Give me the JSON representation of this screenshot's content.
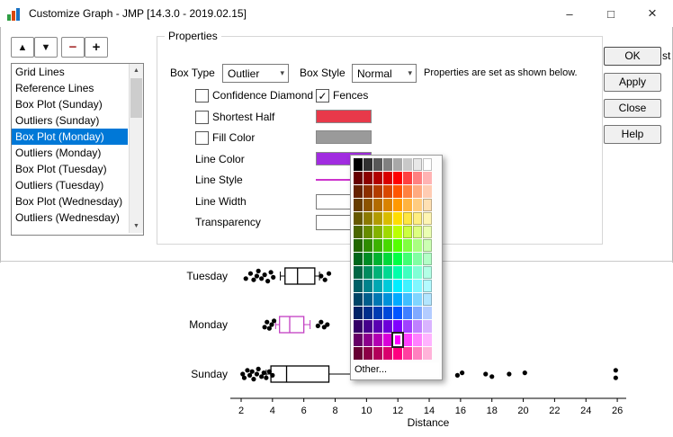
{
  "window": {
    "title": "Customize Graph - JMP [14.3.0 - 2019.02.15]",
    "controls": {
      "minimize": "–",
      "maximize": "□",
      "close": "×"
    },
    "edge_fragment": "st"
  },
  "movers": {
    "up": "▲",
    "down": "▼",
    "remove": "−",
    "add": "+"
  },
  "list": {
    "items": [
      "Grid Lines",
      "Reference Lines",
      "Box Plot (Sunday)",
      "Outliers (Sunday)",
      "Box Plot (Monday)",
      "Outliers (Monday)",
      "Box Plot (Tuesday)",
      "Outliers (Tuesday)",
      "Box Plot (Wednesday)",
      "Outliers (Wednesday)"
    ],
    "selected_index": 4
  },
  "properties": {
    "legend": "Properties",
    "box_type_label": "Box Type",
    "box_type_value": "Outlier",
    "box_style_label": "Box Style",
    "box_style_value": "Normal",
    "note": "Properties are set as shown below.",
    "rows": [
      {
        "type": "checkbox",
        "label": "Confidence Diamond",
        "checked": false,
        "row": 0,
        "col": 0
      },
      {
        "type": "checkbox",
        "label": "Fences",
        "checked": true,
        "row": 0,
        "col": 1
      },
      {
        "type": "checkbox",
        "label": "Shortest Half",
        "checked": false,
        "row": 1,
        "swatch": "#e8394a"
      },
      {
        "type": "checkbox",
        "label": "Fill Color",
        "checked": false,
        "row": 2,
        "swatch": "#9a9a9a"
      },
      {
        "type": "label",
        "label": "Line Color",
        "row": 3,
        "swatch": "#a12ce0"
      },
      {
        "type": "label",
        "label": "Line Style",
        "row": 4,
        "line": "#cc33cc"
      },
      {
        "type": "label",
        "label": "Line Width",
        "row": 5,
        "field": true
      },
      {
        "type": "label",
        "label": "Transparency",
        "row": 6,
        "field": true
      }
    ]
  },
  "action_buttons": [
    "OK",
    "Apply",
    "Close",
    "Help"
  ],
  "palette": {
    "other_label": "Other...",
    "selected": {
      "row": 13,
      "col": 4
    },
    "rows": [
      [
        "#000000",
        "#303030",
        "#585858",
        "#808080",
        "#a8a8a8",
        "#c8c8c8",
        "#e8e8e8",
        "#ffffff"
      ],
      [
        "#660000",
        "#8c0000",
        "#b20000",
        "#d90000",
        "#ff0000",
        "#ff4040",
        "#ff8080",
        "#ffb3b3"
      ],
      [
        "#662200",
        "#8c2f00",
        "#b23c00",
        "#d94800",
        "#ff5500",
        "#ff8040",
        "#ffaa80",
        "#ffccb3"
      ],
      [
        "#663d00",
        "#8c5400",
        "#b26b00",
        "#d98200",
        "#ff9900",
        "#ffb340",
        "#ffcc80",
        "#ffe0b3"
      ],
      [
        "#665800",
        "#8c7a00",
        "#b29b00",
        "#d9bc00",
        "#ffdd00",
        "#ffe640",
        "#ffee80",
        "#fff5b3"
      ],
      [
        "#4b6600",
        "#678c00",
        "#83b200",
        "#9fd900",
        "#bbff00",
        "#ccff40",
        "#ddff80",
        "#ebffb3"
      ],
      [
        "#226600",
        "#2f8c00",
        "#3cb200",
        "#48d900",
        "#55ff00",
        "#80ff40",
        "#aaff80",
        "#ccffb3"
      ],
      [
        "#00661b",
        "#008c25",
        "#00b230",
        "#00d93a",
        "#00ff44",
        "#40ff73",
        "#80ffa2",
        "#b3ffc7"
      ],
      [
        "#006644",
        "#008c5e",
        "#00b277",
        "#00d991",
        "#00ffaa",
        "#40ffbf",
        "#80ffd5",
        "#b3ffe6"
      ],
      [
        "#005f66",
        "#00838c",
        "#00a7b2",
        "#00cad9",
        "#00eeff",
        "#40f2ff",
        "#80f7ff",
        "#b3faff"
      ],
      [
        "#004466",
        "#005e8c",
        "#0077b2",
        "#0091d9",
        "#00aaff",
        "#40bfff",
        "#80d5ff",
        "#b3e6ff"
      ],
      [
        "#002266",
        "#002f8c",
        "#003cb2",
        "#0048d9",
        "#0055ff",
        "#4080ff",
        "#80aaff",
        "#b3ccff"
      ],
      [
        "#330066",
        "#46008c",
        "#5a00b2",
        "#6d00d9",
        "#8000ff",
        "#a040ff",
        "#bf80ff",
        "#d9b3ff"
      ],
      [
        "#660066",
        "#8c008c",
        "#b200b2",
        "#d900d9",
        "#ff00ff",
        "#ff40ff",
        "#ff80ff",
        "#ffb3ff"
      ],
      [
        "#660033",
        "#8c0046",
        "#b2005a",
        "#d9006d",
        "#ff0080",
        "#ff40a0",
        "#ff80bf",
        "#ffb3d9"
      ]
    ]
  },
  "chart_data": {
    "type": "boxplot-dot",
    "xlabel": "Distance",
    "x_ticks": [
      2,
      4,
      6,
      8,
      10,
      12,
      14,
      16,
      18,
      20,
      22,
      24,
      26
    ],
    "x_range": [
      1.2,
      27
    ],
    "grid": false,
    "categories": [
      "Tuesday",
      "Monday",
      "Sunday"
    ],
    "series": [
      {
        "name": "Tuesday",
        "color": "#000000",
        "box": {
          "lo": 4.5,
          "q1": 4.8,
          "med": 5.6,
          "q3": 6.7,
          "hi": 7.0
        },
        "points": [
          [
            2.3,
            2
          ],
          [
            2.6,
            -2
          ],
          [
            2.8,
            3
          ],
          [
            3.0,
            0
          ],
          [
            3.1,
            -4
          ],
          [
            3.3,
            2
          ],
          [
            3.5,
            -1
          ],
          [
            3.7,
            4
          ],
          [
            3.9,
            -3
          ],
          [
            4.05,
            1
          ],
          [
            7.1,
            0
          ],
          [
            7.35,
            3
          ],
          [
            7.6,
            -2
          ]
        ]
      },
      {
        "name": "Monday",
        "color": "#c23fc2",
        "box": {
          "lo": 4.2,
          "q1": 4.45,
          "med": 5.1,
          "q3": 6.0,
          "hi": 6.4
        },
        "points": [
          [
            3.5,
            2
          ],
          [
            3.65,
            -2
          ],
          [
            3.8,
            3
          ],
          [
            3.95,
            0
          ],
          [
            4.1,
            -3
          ],
          [
            6.9,
            1
          ],
          [
            7.1,
            -2
          ],
          [
            7.3,
            2
          ],
          [
            7.5,
            0
          ]
        ]
      },
      {
        "name": "Sunday",
        "color": "#000000",
        "box": {
          "lo": 3.6,
          "q1": 3.9,
          "med": 4.9,
          "q3": 7.6,
          "hi": 9.1
        },
        "points": [
          [
            2.1,
            0
          ],
          [
            2.2,
            3
          ],
          [
            2.4,
            -3
          ],
          [
            2.55,
            1
          ],
          [
            2.7,
            -2
          ],
          [
            2.8,
            4
          ],
          [
            3.0,
            0
          ],
          [
            3.1,
            -4
          ],
          [
            3.3,
            2
          ],
          [
            3.45,
            -1
          ],
          [
            3.6,
            3
          ],
          [
            3.8,
            -2
          ],
          [
            4.0,
            1
          ],
          [
            10.3,
            0
          ],
          [
            11.0,
            2
          ],
          [
            11.6,
            -2
          ],
          [
            12.2,
            0
          ],
          [
            12.8,
            2
          ],
          [
            13.4,
            -1
          ],
          [
            14.6,
            0
          ],
          [
            15.8,
            1
          ],
          [
            16.1,
            -1
          ],
          [
            17.6,
            0
          ],
          [
            18.0,
            2
          ],
          [
            19.1,
            0
          ],
          [
            20.1,
            -1
          ],
          [
            25.9,
            3
          ],
          [
            25.9,
            -3
          ]
        ]
      }
    ]
  }
}
